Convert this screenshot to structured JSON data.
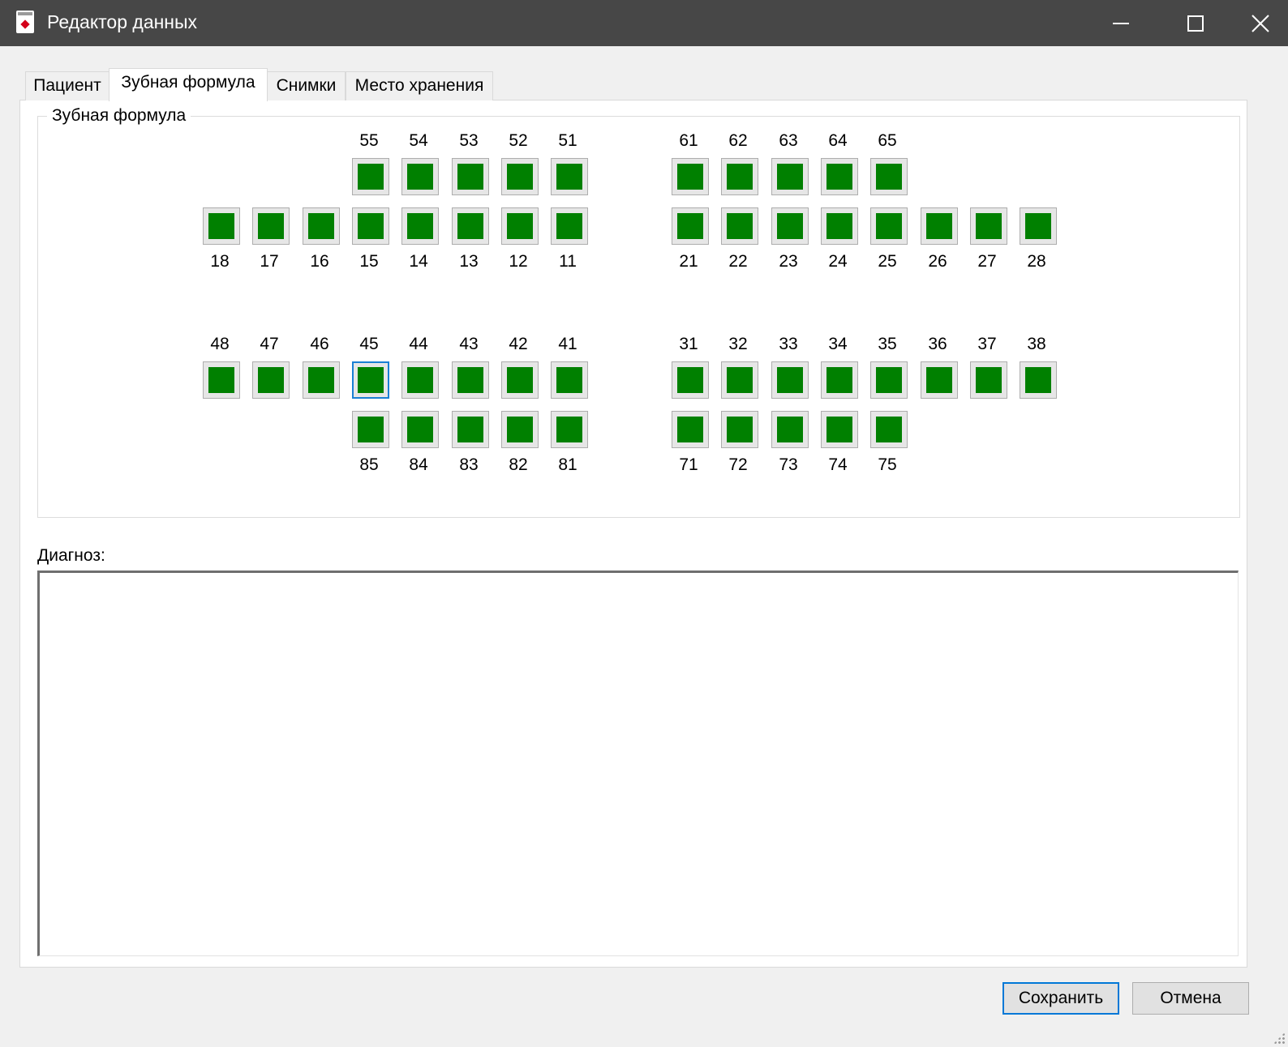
{
  "window": {
    "title": "Редактор данных",
    "controls": {
      "minimize": "—",
      "maximize": "☐",
      "close": "✕"
    }
  },
  "tabs": [
    "Пациент",
    "Зубная формула",
    "Снимки",
    "Место хранения"
  ],
  "active_tab": "Зубная формула",
  "dental_formula": {
    "group_title": "Зубная формула",
    "fill_color": "#008000",
    "selected_color": "#1a7fd4",
    "selected_tooth": "45",
    "rows": {
      "upper_deciduous": {
        "labels_position": "above",
        "right": [
          "55",
          "54",
          "53",
          "52",
          "51"
        ],
        "left": [
          "61",
          "62",
          "63",
          "64",
          "65"
        ]
      },
      "upper_permanent": {
        "labels_position": "below",
        "right": [
          "18",
          "17",
          "16",
          "15",
          "14",
          "13",
          "12",
          "11"
        ],
        "left": [
          "21",
          "22",
          "23",
          "24",
          "25",
          "26",
          "27",
          "28"
        ]
      },
      "lower_permanent": {
        "labels_position": "above",
        "right": [
          "48",
          "47",
          "46",
          "45",
          "44",
          "43",
          "42",
          "41"
        ],
        "left": [
          "31",
          "32",
          "33",
          "34",
          "35",
          "36",
          "37",
          "38"
        ]
      },
      "lower_deciduous": {
        "labels_position": "below",
        "right": [
          "85",
          "84",
          "83",
          "82",
          "81"
        ],
        "left": [
          "71",
          "72",
          "73",
          "74",
          "75"
        ]
      }
    }
  },
  "diagnosis": {
    "label": "Диагноз:",
    "value": ""
  },
  "buttons": {
    "save": "Сохранить",
    "cancel": "Отмена"
  }
}
